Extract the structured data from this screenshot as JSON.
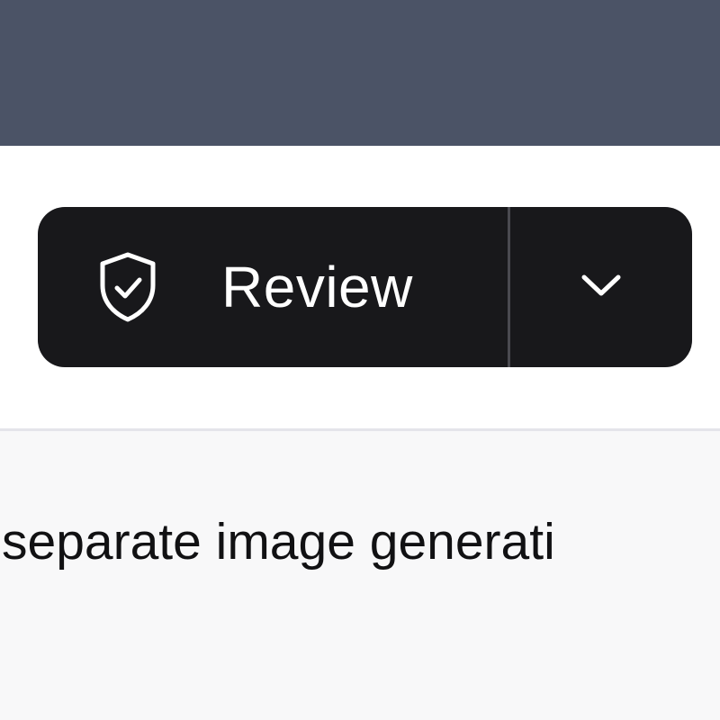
{
  "header": {
    "color": "#4b5366"
  },
  "toolbar": {
    "review_button": {
      "label": "Review",
      "icon": "shield-check-icon",
      "background": "#18181b"
    },
    "menu_toggle": {
      "icon": "chevron-down-icon"
    }
  },
  "content": {
    "text": "separate image generati"
  }
}
